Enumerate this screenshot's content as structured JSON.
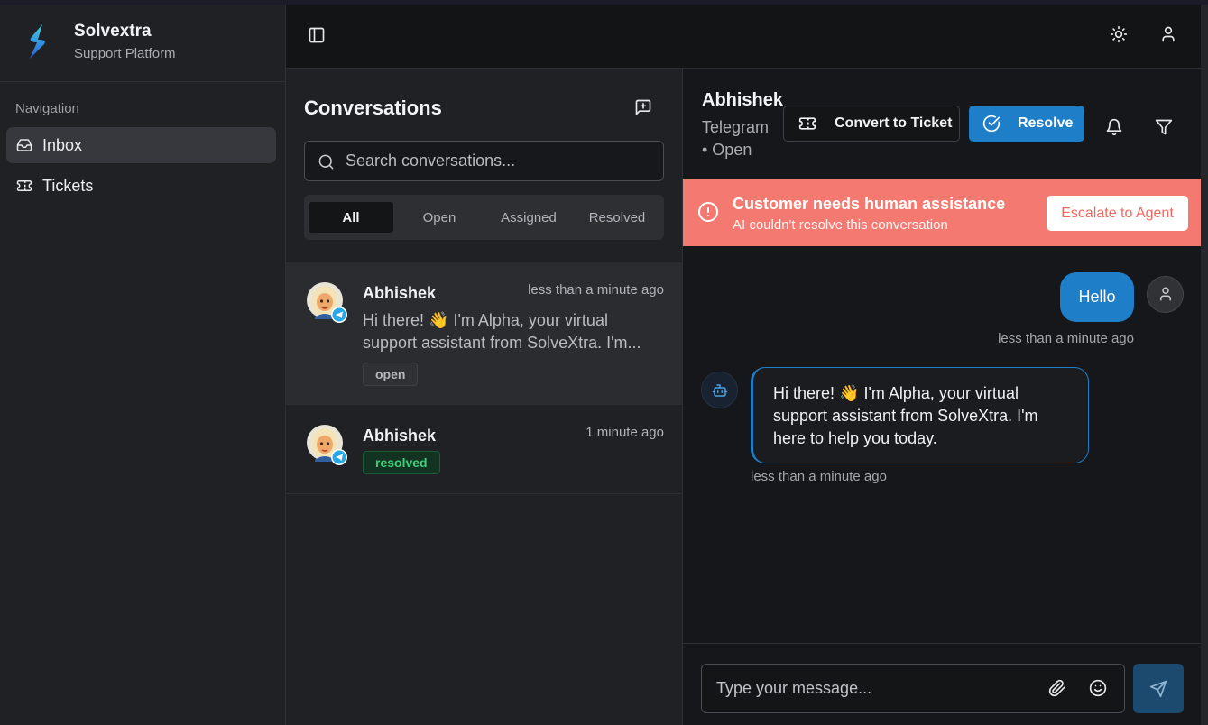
{
  "brand": {
    "name": "Solvextra",
    "subtitle": "Support Platform"
  },
  "nav": {
    "title": "Navigation",
    "items": [
      {
        "label": "Inbox",
        "icon": "inbox-icon",
        "active": true
      },
      {
        "label": "Tickets",
        "icon": "ticket-icon",
        "active": false
      }
    ]
  },
  "header": {
    "icons": [
      "sidebar-toggle-icon",
      "sun-icon",
      "user-icon"
    ]
  },
  "conversations": {
    "title": "Conversations",
    "search_placeholder": "Search conversations...",
    "filters": [
      {
        "label": "All",
        "active": true
      },
      {
        "label": "Open",
        "active": false
      },
      {
        "label": "Assigned",
        "active": false
      },
      {
        "label": "Resolved",
        "active": false
      }
    ],
    "items": [
      {
        "name": "Abhishek",
        "time": "less than a minute ago",
        "preview": "Hi there! 👋 I'm Alpha, your virtual support assistant from SolveXtra. I'm...",
        "status": "open",
        "channel": "telegram"
      },
      {
        "name": "Abhishek",
        "time": "1 minute ago",
        "preview": "",
        "status": "resolved",
        "channel": "telegram"
      }
    ]
  },
  "chat": {
    "name": "Abhishek",
    "channel": "Telegram",
    "status": "• Open",
    "convert_label": "Convert to Ticket",
    "resolve_label": "Resolve",
    "alert": {
      "title": "Customer needs human assistance",
      "subtitle": "AI couldn't resolve this conversation",
      "action": "Escalate to Agent"
    },
    "messages": [
      {
        "sender": "user",
        "text": "Hello",
        "time": "less than a minute ago"
      },
      {
        "sender": "bot",
        "text": "Hi there! 👋 I'm Alpha, your virtual support assistant from SolveXtra. I'm here to help you today.",
        "time": "less than a minute ago"
      }
    ],
    "composer_placeholder": "Type your message..."
  },
  "colors": {
    "accent": "#1e7ec8",
    "alert": "#f47a71",
    "resolved": "#3ed07a"
  }
}
